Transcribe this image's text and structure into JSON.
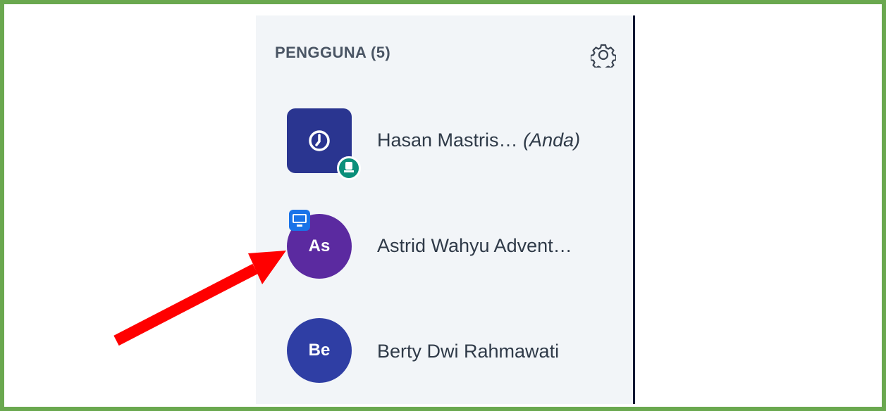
{
  "panel": {
    "header": "PENGGUNA (5)",
    "settings_icon": "gear-icon"
  },
  "users": [
    {
      "name": "Hasan Mastris…",
      "suffix": "(Anda)",
      "avatar_icon": "clock-icon",
      "avatar_color": "#2a3590",
      "badge": "presenter-icon",
      "badge_color": "#0b8f7a"
    },
    {
      "name": "Astrid Wahyu Advent…",
      "initials": "As",
      "avatar_color": "#5b2aa0",
      "badge": "screen-share-icon",
      "badge_color": "#1a73e8"
    },
    {
      "name": "Berty Dwi Rahmawati",
      "initials": "Be",
      "avatar_color": "#2f3ea4"
    }
  ],
  "annotation": {
    "arrow_color": "#ff0000",
    "frame_color": "#6aa84f",
    "panel_border_color": "#0b1733"
  }
}
